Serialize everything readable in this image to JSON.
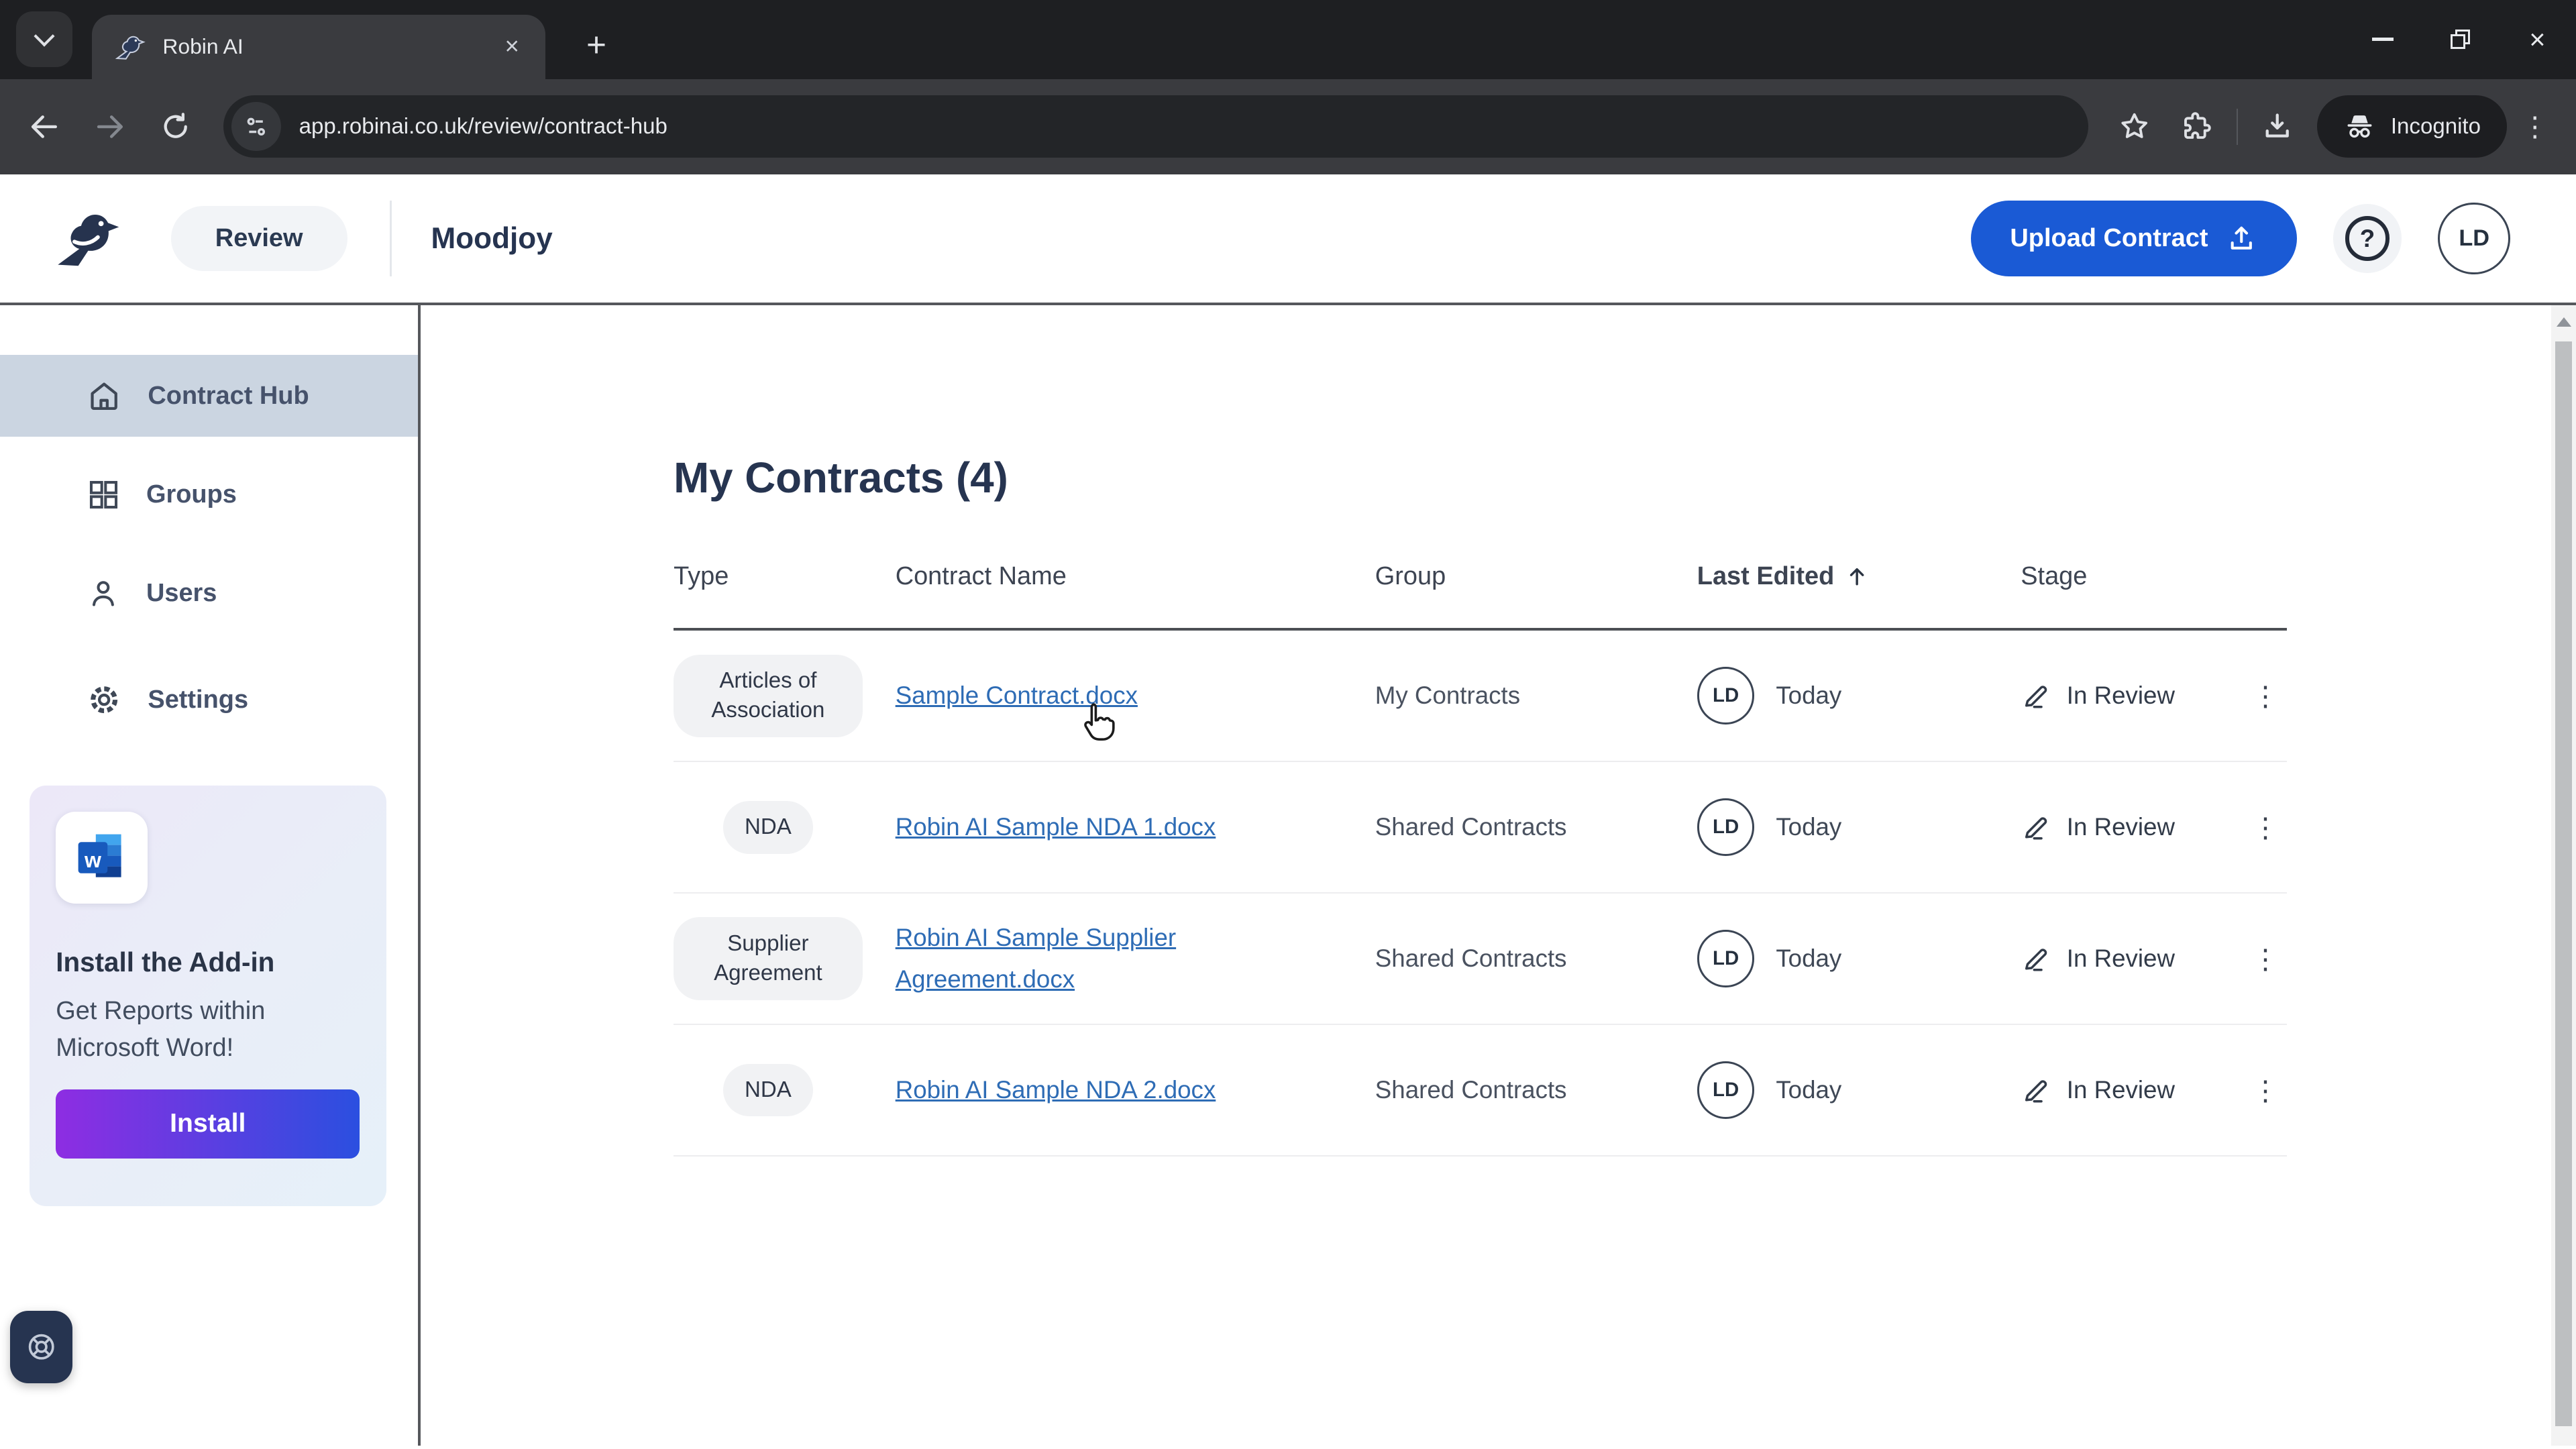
{
  "browser": {
    "tab_title": "Robin AI",
    "url": "app.robinai.co.uk/review/contract-hub",
    "incognito_label": "Incognito"
  },
  "glyphs": {
    "close": "×",
    "plus": "+",
    "kebab": "⋮"
  },
  "header": {
    "nav_review": "Review",
    "workspace_name": "Moodjoy",
    "upload_button": "Upload Contract",
    "help": "?",
    "avatar_initials": "LD"
  },
  "sidebar": {
    "items": [
      {
        "label": "Contract Hub",
        "active": true
      },
      {
        "label": "Groups",
        "active": false
      },
      {
        "label": "Users",
        "active": false
      },
      {
        "label": "Settings",
        "active": false
      }
    ],
    "promo": {
      "title": "Install the Add-in",
      "body": "Get Reports within Microsoft Word!",
      "button": "Install"
    }
  },
  "main": {
    "title": "My Contracts (4)",
    "table": {
      "headers": [
        "Type",
        "Contract Name",
        "Group",
        "Last Edited",
        "Stage"
      ],
      "sorted_by": "Last Edited",
      "sort_direction": "asc",
      "rows": [
        {
          "type": "Articles of Association",
          "name": "Sample Contract.docx",
          "group": "My Contracts",
          "editor_initials": "LD",
          "last_edited": "Today",
          "stage": "In Review"
        },
        {
          "type": "NDA",
          "name": "Robin AI Sample NDA 1.docx",
          "group": "Shared Contracts",
          "editor_initials": "LD",
          "last_edited": "Today",
          "stage": "In Review"
        },
        {
          "type": "Supplier Agreement",
          "name": "Robin AI Sample Supplier Agreement.docx",
          "group": "Shared Contracts",
          "editor_initials": "LD",
          "last_edited": "Today",
          "stage": "In Review"
        },
        {
          "type": "NDA",
          "name": "Robin AI Sample NDA 2.docx",
          "group": "Shared Contracts",
          "editor_initials": "LD",
          "last_edited": "Today",
          "stage": "In Review"
        }
      ]
    }
  },
  "colors": {
    "accent_blue": "#1a5ad5",
    "link_blue": "#2e6cb5",
    "navy_text": "#263450",
    "active_sidebar_bg": "#cbd5e1",
    "install_gradient_start": "#8e2de2",
    "install_gradient_end": "#2b4fe0",
    "browser_dark": "#1e1f22",
    "toolbar_dark": "#3a3b3f"
  }
}
